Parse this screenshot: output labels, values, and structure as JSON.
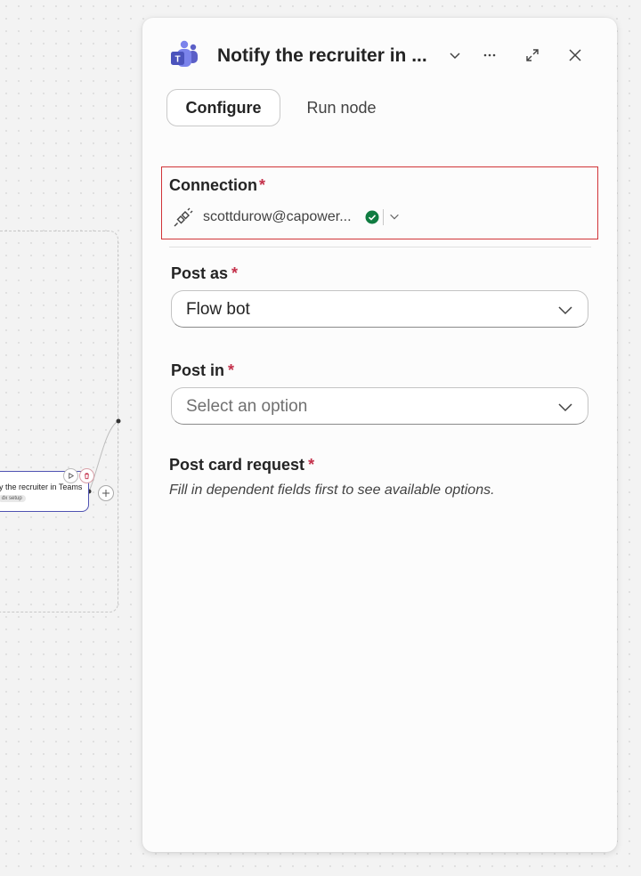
{
  "canvas": {
    "node_title": "y the recruiter in Teams",
    "node_badge": "dx setup"
  },
  "panel": {
    "title": "Notify the recruiter in ...",
    "tabs": {
      "configure": "Configure",
      "run_node": "Run node"
    },
    "connection": {
      "label": "Connection",
      "required_mark": "*",
      "account": "scottdurow@capower...",
      "status": "connected",
      "accent_color": "#d13438"
    },
    "post_as": {
      "label": "Post as",
      "required_mark": "*",
      "value": "Flow bot"
    },
    "post_in": {
      "label": "Post in",
      "required_mark": "*",
      "placeholder": "Select an option"
    },
    "post_card": {
      "label": "Post card request",
      "required_mark": "*",
      "helper": "Fill in dependent fields first to see available options."
    }
  },
  "colors": {
    "brand_teams": "#5b5fc7",
    "required": "#c4314b",
    "success": "#107c41",
    "error_border": "#d13438"
  },
  "icons": [
    "teams-icon",
    "chevron-down-icon",
    "more-icon",
    "expand-icon",
    "close-icon",
    "plug-icon",
    "check-circle-icon",
    "run-icon",
    "delete-icon",
    "add-icon"
  ]
}
